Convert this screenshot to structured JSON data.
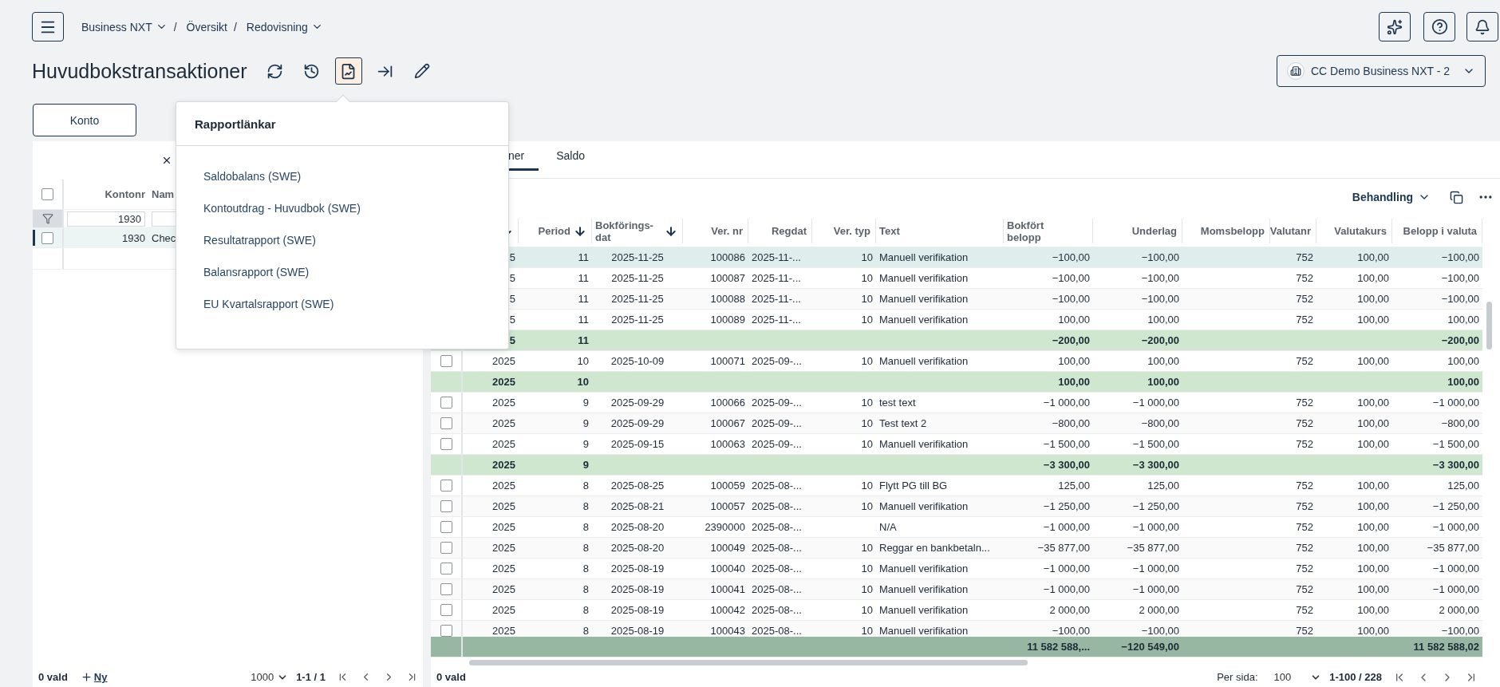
{
  "topbar": {
    "separator": "/",
    "breadcrumbs": [
      {
        "label": "Business NXT",
        "dropdown": true
      },
      {
        "label": "Översikt",
        "dropdown": false
      },
      {
        "label": "Redovisning",
        "dropdown": true
      }
    ],
    "company": "CC Demo Business NXT - 2"
  },
  "page_title": "Huvudbokstransaktioner",
  "toolbar": [
    {
      "kind": "refresh",
      "selected": false
    },
    {
      "kind": "history",
      "selected": false
    },
    {
      "kind": "report",
      "selected": true
    },
    {
      "kind": "goto-end",
      "selected": false
    },
    {
      "kind": "edit",
      "selected": false
    }
  ],
  "report_links": {
    "title": "Rapportlänkar",
    "items": [
      "Saldobalans (SWE)",
      "Kontoutdrag - Huvudbok (SWE)",
      "Resultatrapport (SWE)",
      "Balansrapport (SWE)",
      "EU Kvartalsrapport (SWE)"
    ]
  },
  "account_button": "Konto",
  "account_panel": {
    "header_checked": false,
    "columns": [
      "Kontonr",
      "Nam"
    ],
    "filter_value": "1930",
    "rows": [
      {
        "kontonr": "1930",
        "name": "Chec",
        "selected": true,
        "checked": false
      }
    ],
    "footer": {
      "selected_count": "0 vald",
      "new": "Ny",
      "page_size": "1000",
      "range": "1-1 / 1"
    }
  },
  "transactions": {
    "tabs": [
      {
        "label": "ner",
        "selected": true
      },
      {
        "label": "Saldo",
        "selected": false
      }
    ],
    "action": "Behandling",
    "columns": [
      {
        "sorted": true
      },
      {
        "label": "Period",
        "sorted": true
      },
      {
        "label": "Bokförings-dat",
        "sorted": true
      },
      {
        "label": "Ver. nr",
        "sorted": false
      },
      {
        "label": "Regdat",
        "sorted": false
      },
      {
        "label": "Ver. typ",
        "sorted": false
      },
      {
        "label": "Text",
        "sorted": false
      },
      {
        "label": "Bokfört belopp",
        "sorted": false
      },
      {
        "label": "Underlag",
        "sorted": false
      },
      {
        "label": "Momsbelopp",
        "sorted": false
      },
      {
        "label": "Valutanr",
        "sorted": false
      },
      {
        "label": "Valutakurs",
        "sorted": false
      },
      {
        "label": "Belopp i valuta",
        "sorted": false
      }
    ],
    "rows": [
      {
        "kind": "data",
        "selected": true,
        "year": "5",
        "period": "11",
        "date": "2025-11-25",
        "ver_nr": "100086",
        "regdat": "2025-11-...",
        "ver_typ": "10",
        "text": "Manuell verifikation",
        "bokfort": "−100,00",
        "underlag": "−100,00",
        "valutanr": "752",
        "valutakurs": "100,00",
        "belopp_valuta": "−100,00"
      },
      {
        "kind": "data",
        "selected": false,
        "year": "5",
        "period": "11",
        "date": "2025-11-25",
        "ver_nr": "100087",
        "regdat": "2025-11-...",
        "ver_typ": "10",
        "text": "Manuell verifikation",
        "bokfort": "−100,00",
        "underlag": "−100,00",
        "valutanr": "752",
        "valutakurs": "100,00",
        "belopp_valuta": "−100,00"
      },
      {
        "kind": "data",
        "selected": false,
        "year": "5",
        "period": "11",
        "date": "2025-11-25",
        "ver_nr": "100088",
        "regdat": "2025-11-...",
        "ver_typ": "10",
        "text": "Manuell verifikation",
        "bokfort": "−100,00",
        "underlag": "−100,00",
        "valutanr": "752",
        "valutakurs": "100,00",
        "belopp_valuta": "−100,00"
      },
      {
        "kind": "data",
        "selected": false,
        "year": "5",
        "period": "11",
        "date": "2025-11-25",
        "ver_nr": "100089",
        "regdat": "2025-11-...",
        "ver_typ": "10",
        "text": "Manuell verifikation",
        "bokfort": "100,00",
        "underlag": "100,00",
        "valutanr": "752",
        "valutakurs": "100,00",
        "belopp_valuta": "100,00"
      },
      {
        "kind": "subtotal",
        "year": "5",
        "period": "11",
        "bokfort": "−200,00",
        "underlag": "−200,00",
        "belopp_valuta": "−200,00"
      },
      {
        "kind": "data",
        "selected": false,
        "checked": false,
        "year": "2025",
        "period": "10",
        "date": "2025-10-09",
        "ver_nr": "100071",
        "regdat": "2025-09-...",
        "ver_typ": "10",
        "text": "Manuell verifikation",
        "bokfort": "100,00",
        "underlag": "100,00",
        "valutanr": "752",
        "valutakurs": "100,00",
        "belopp_valuta": "100,00"
      },
      {
        "kind": "subtotal",
        "year": "2025",
        "period": "10",
        "bokfort": "100,00",
        "underlag": "100,00",
        "belopp_valuta": "100,00"
      },
      {
        "kind": "data",
        "selected": false,
        "checked": false,
        "year": "2025",
        "period": "9",
        "date": "2025-09-29",
        "ver_nr": "100066",
        "regdat": "2025-09-...",
        "ver_typ": "10",
        "text": "test text",
        "bokfort": "−1 000,00",
        "underlag": "−1 000,00",
        "valutanr": "752",
        "valutakurs": "100,00",
        "belopp_valuta": "−1 000,00"
      },
      {
        "kind": "data",
        "selected": false,
        "checked": false,
        "year": "2025",
        "period": "9",
        "date": "2025-09-29",
        "ver_nr": "100067",
        "regdat": "2025-09-...",
        "ver_typ": "10",
        "text": "Test text 2",
        "bokfort": "−800,00",
        "underlag": "−800,00",
        "valutanr": "752",
        "valutakurs": "100,00",
        "belopp_valuta": "−800,00"
      },
      {
        "kind": "data",
        "selected": false,
        "checked": false,
        "year": "2025",
        "period": "9",
        "date": "2025-09-15",
        "ver_nr": "100063",
        "regdat": "2025-09-...",
        "ver_typ": "10",
        "text": "Manuell verifikation",
        "bokfort": "−1 500,00",
        "underlag": "−1 500,00",
        "valutanr": "752",
        "valutakurs": "100,00",
        "belopp_valuta": "−1 500,00"
      },
      {
        "kind": "subtotal",
        "year": "2025",
        "period": "9",
        "bokfort": "−3 300,00",
        "underlag": "−3 300,00",
        "belopp_valuta": "−3 300,00"
      },
      {
        "kind": "data",
        "selected": false,
        "checked": false,
        "year": "2025",
        "period": "8",
        "date": "2025-08-25",
        "ver_nr": "100059",
        "regdat": "2025-08-...",
        "ver_typ": "10",
        "text": "Flytt PG till BG",
        "bokfort": "125,00",
        "underlag": "125,00",
        "valutanr": "752",
        "valutakurs": "100,00",
        "belopp_valuta": "125,00"
      },
      {
        "kind": "data",
        "selected": false,
        "checked": false,
        "year": "2025",
        "period": "8",
        "date": "2025-08-21",
        "ver_nr": "100057",
        "regdat": "2025-08-...",
        "ver_typ": "10",
        "text": "Manuell verifikation",
        "bokfort": "−1 250,00",
        "underlag": "−1 250,00",
        "valutanr": "752",
        "valutakurs": "100,00",
        "belopp_valuta": "−1 250,00"
      },
      {
        "kind": "data",
        "selected": false,
        "checked": false,
        "year": "2025",
        "period": "8",
        "date": "2025-08-20",
        "ver_nr": "2390000",
        "regdat": "2025-08-...",
        "text": "N/A",
        "bokfort": "−1 000,00",
        "underlag": "−1 000,00",
        "valutanr": "752",
        "valutakurs": "100,00",
        "belopp_valuta": "−1 000,00"
      },
      {
        "kind": "data",
        "selected": false,
        "checked": false,
        "year": "2025",
        "period": "8",
        "date": "2025-08-20",
        "ver_nr": "100049",
        "regdat": "2025-08-...",
        "ver_typ": "10",
        "text": "Reggar en bankbetaln...",
        "bokfort": "−35 877,00",
        "underlag": "−35 877,00",
        "valutanr": "752",
        "valutakurs": "100,00",
        "belopp_valuta": "−35 877,00"
      },
      {
        "kind": "data",
        "selected": false,
        "checked": false,
        "year": "2025",
        "period": "8",
        "date": "2025-08-19",
        "ver_nr": "100040",
        "regdat": "2025-08-...",
        "ver_typ": "10",
        "text": "Manuell verifikation",
        "bokfort": "−1 000,00",
        "underlag": "−1 000,00",
        "valutanr": "752",
        "valutakurs": "100,00",
        "belopp_valuta": "−1 000,00"
      },
      {
        "kind": "data",
        "selected": false,
        "checked": false,
        "year": "2025",
        "period": "8",
        "date": "2025-08-19",
        "ver_nr": "100041",
        "regdat": "2025-08-...",
        "ver_typ": "10",
        "text": "Manuell verifikation",
        "bokfort": "−1 000,00",
        "underlag": "−1 000,00",
        "valutanr": "752",
        "valutakurs": "100,00",
        "belopp_valuta": "−1 000,00"
      },
      {
        "kind": "data",
        "selected": false,
        "checked": false,
        "year": "2025",
        "period": "8",
        "date": "2025-08-19",
        "ver_nr": "100042",
        "regdat": "2025-08-...",
        "ver_typ": "10",
        "text": "Manuell verifikation",
        "bokfort": "2 000,00",
        "underlag": "2 000,00",
        "valutanr": "752",
        "valutakurs": "100,00",
        "belopp_valuta": "2 000,00"
      },
      {
        "kind": "data",
        "selected": false,
        "checked": false,
        "year": "2025",
        "period": "8",
        "date": "2025-08-19",
        "ver_nr": "100043",
        "regdat": "2025-08-...",
        "ver_typ": "10",
        "text": "Manuell verifikation",
        "bokfort": "−100,00",
        "underlag": "−100,00",
        "valutanr": "752",
        "valutakurs": "100,00",
        "belopp_valuta": "−100,00"
      }
    ],
    "totals": {
      "bokfort": "11 582 588,...",
      "underlag": "−120 549,00",
      "belopp_valuta": "11 582 588,02"
    },
    "footer": {
      "selected_count": "0 vald",
      "per_page_label": "Per sida:",
      "page_size": "100",
      "range": "1-100 / 228"
    }
  }
}
